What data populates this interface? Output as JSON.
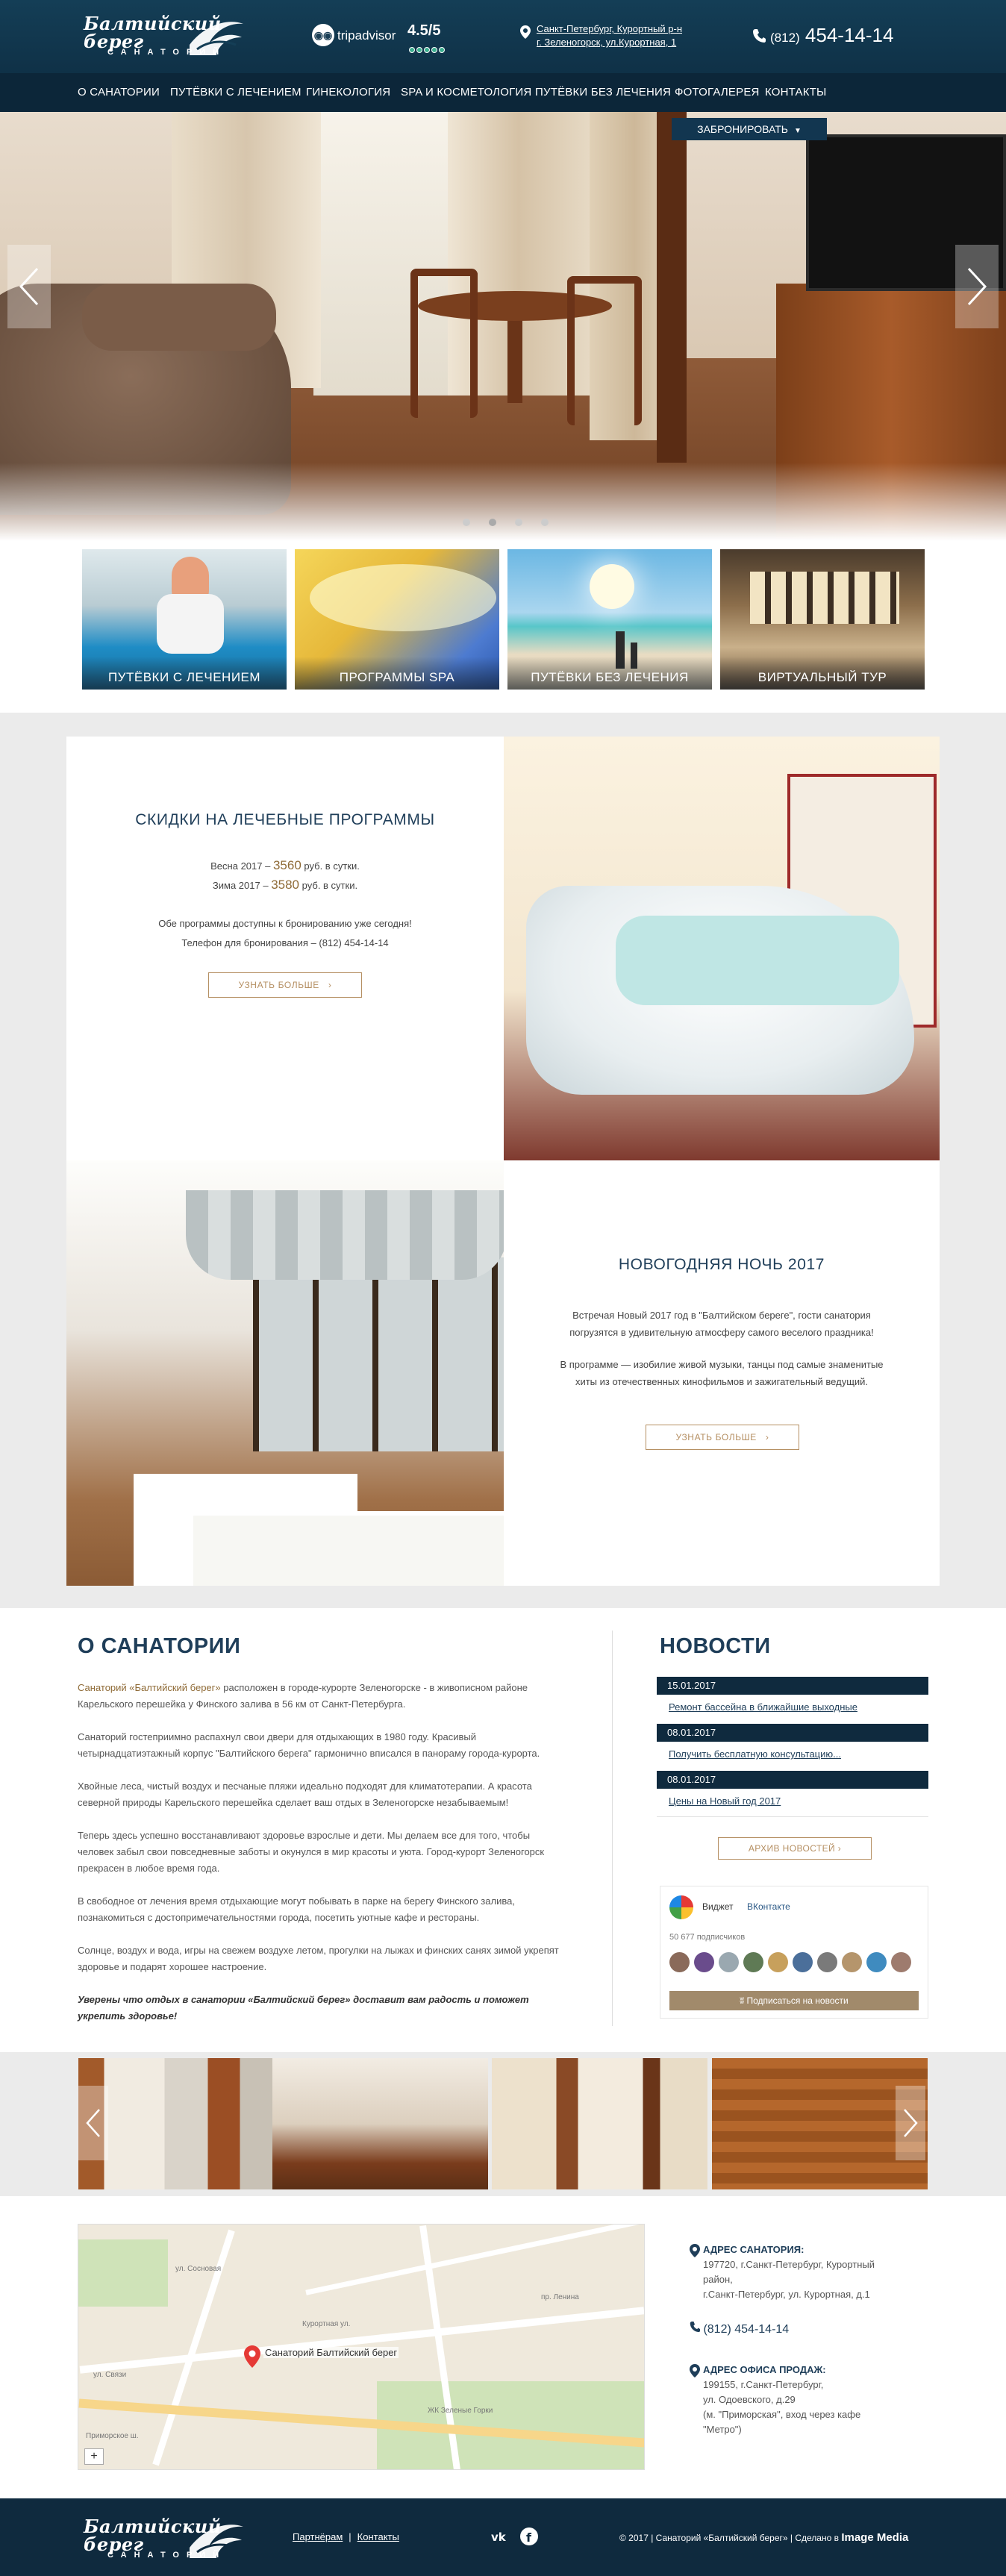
{
  "header": {
    "logo_name": "Балтийский берег",
    "logo_sub": "САНАТОРИЙ",
    "tripadvisor": {
      "name": "tripadvisor",
      "score": "4.5/5"
    },
    "address_lines": [
      "Санкт-Петербург, Курортный р-н",
      "г. Зеленогорск, ул.Курортная, 1"
    ],
    "phone_code": "(812)",
    "phone_number": "454-14-14"
  },
  "nav": {
    "items": [
      "О САНАТОРИИ",
      "ПУТЁВКИ С ЛЕЧЕНИЕМ",
      "ГИНЕКОЛОГИЯ",
      "SPA И КОСМЕТОЛОГИЯ",
      "ПУТЁВКИ БЕЗ ЛЕЧЕНИЯ",
      "ФОТОГАЛЕРЕЯ",
      "КОНТАКТЫ"
    ]
  },
  "hero": {
    "book_label": "ЗАБРОНИРОВАТЬ",
    "slide_count": 4,
    "active_slide": 1
  },
  "tiles": [
    "ПУТЁВКИ С ЛЕЧЕНИЕМ",
    "ПРОГРАММЫ SPA",
    "ПУТЁВКИ БЕЗ ЛЕЧЕНИЯ",
    "ВИРТУАЛЬНЫЙ ТУР"
  ],
  "promo1": {
    "title": "СКИДКИ НА ЛЕЧЕБНЫЕ ПРОГРАММЫ",
    "line1_pre": "Весна 2017 –",
    "line1_price": "3560",
    "line1_post": "руб. в сутки.",
    "line2_pre": "Зима 2017 –",
    "line2_price": "3580",
    "line2_post": "руб. в сутки.",
    "line3": "Обе программы доступны к бронированию уже сегодня!",
    "line4": "Телефон для бронирования – (812) 454-14-14",
    "button": "УЗНАТЬ БОЛЬШЕ"
  },
  "promo2": {
    "title": "НОВОГОДНЯЯ НОЧЬ 2017",
    "p1": "Встречая Новый 2017 год в \"Балтийском береге\", гости санатория погрузятся в удивительную атмосферу самого веселого праздника!",
    "p2": "В программе — изобилие живой музыки, танцы под самые знаменитые хиты из отечественных кинофильмов и зажигательный ведущий.",
    "button": "УЗНАТЬ БОЛЬШЕ"
  },
  "about": {
    "title": "О САНАТОРИИ",
    "p1_hl": "Санаторий «Балтийский берег»",
    "p1_rest": " расположен в городе-курорте Зеленогорске - в живописном районе Карельского перешейка у Финского залива в 56 км от Санкт-Петербурга.",
    "p2": "Санаторий гостеприимно распахнул свои двери для отдыхающих в 1980 году. Красивый четырнадцатиэтажный корпус \"Балтийского берега\" гармонично вписался в панораму города-курорта.",
    "p3": "Хвойные леса, чистый воздух и песчаные пляжи идеально подходят для климатотерапии. А красота северной природы Карельского перешейка сделает ваш отдых в Зеленогорске незабываемым!",
    "p4": "Теперь здесь успешно восстанавливают здоровье взрослые и дети. Мы делаем все для того, чтобы человек забыл свои повседневные заботы и окунулся в мир красоты и уюта. Город-курорт Зеленогорск прекрасен в любое время года.",
    "p5": "В свободное от лечения время отдыхающие могут побывать в парке на берегу Финского залива, познакомиться с достопримечательностями города, посетить уютные кафе и рестораны.",
    "p6": "Солнце, воздух и вода, игры на свежем воздухе летом, прогулки на лыжах и финских санях зимой укрепят здоровье и подарят хорошее настроение.",
    "final": "Уверены что отдых в санатории «Балтийский берег» доставит вам радость и поможет укрепить здоровье!"
  },
  "news": {
    "title": "НОВОСТИ",
    "items": [
      {
        "date": "15.01.2017",
        "text": "Ремонт бассейна в ближайшие выходные"
      },
      {
        "date": "08.01.2017",
        "text": "Получить бесплатную консультацию..."
      },
      {
        "date": "08.01.2017",
        "text": "Цены на Новый год 2017"
      }
    ],
    "archive_label": "АРХИВ НОВОСТЕЙ"
  },
  "vk": {
    "widget_label": "Виджет",
    "network": "ВКонтакте",
    "subscribers": "50 677 подписчиков",
    "subscribe_label": "Подписаться на новости"
  },
  "contacts": {
    "map_label": "Санаторий Балтийский берег",
    "san_label": "АДРЕС САНАТОРИЯ:",
    "san_lines": [
      "197720, г.Санкт-Петербург, Курортный",
      "район,",
      "г.Санкт-Петербург, ул. Курортная, д.1"
    ],
    "phone": "(812) 454-14-14",
    "office_label": "АДРЕС ОФИСА ПРОДАЖ:",
    "office_lines": [
      "199155, г.Санкт-Петербург,",
      "ул. Одоевского, д.29",
      "(м. \"Приморская\", вход через кафе",
      "\"Метро\")"
    ],
    "streets": [
      "Курортная ул.",
      "ул. Связи",
      "пр. Ленина",
      "Приморское ш.",
      "ул. Сосновая",
      "ЖК Зеленые Горки"
    ]
  },
  "footer": {
    "links": [
      "Партнёрам",
      "Контакты"
    ],
    "copyright": "© 2017 | Санаторий «Балтийский берег» | Сделано в",
    "studio": "Image Media"
  },
  "colors": {
    "navy": "#0f2a3e",
    "gold": "#b58f62",
    "title": "#1f3e59"
  }
}
